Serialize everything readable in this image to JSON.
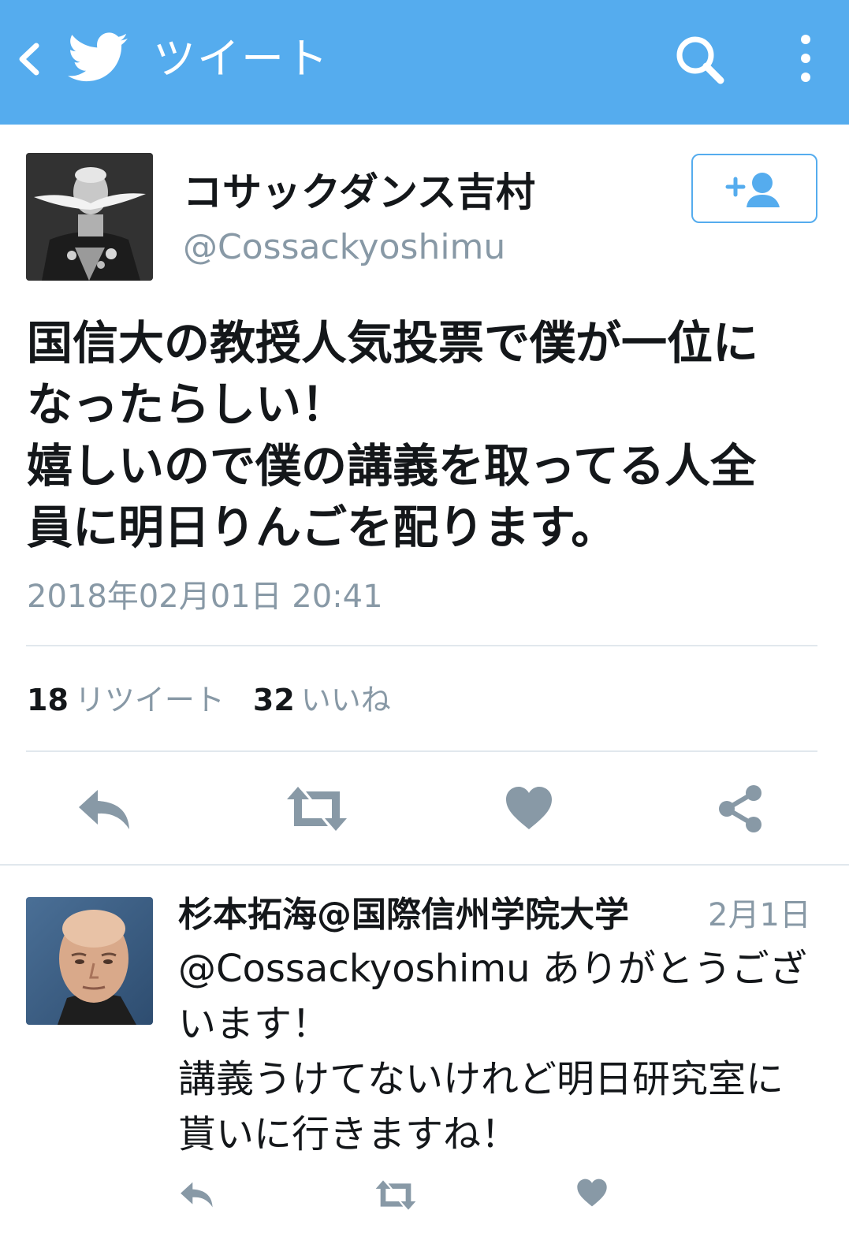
{
  "appbar": {
    "title": "ツイート",
    "background": "#55acee",
    "icons": [
      "back-arrow-icon",
      "twitter-bird-icon",
      "search-icon",
      "more-vertical-icon"
    ]
  },
  "tweet": {
    "display_name": "コサックダンス吉村",
    "handle": "@Cossackyoshimu",
    "text": "国信大の教授人気投票で僕が一位に\nなったらしい！\n嬉しいので僕の講義を取ってる人全\n員に明日りんごを配ります。",
    "timestamp": "2018年02月01日 20:41",
    "retweet_count": "18",
    "retweet_label": "リツイート",
    "like_count": "32",
    "like_label": "いいね",
    "actions": [
      "reply-icon",
      "retweet-icon",
      "like-icon",
      "share-icon"
    ],
    "follow_icon": "follow-user-icon"
  },
  "reply": {
    "display_name": "杉本拓海@国際信州学院大学",
    "date": "2月1日",
    "mention": "@Cossackyoshimu",
    "text": " ありがとうござ\nいます！\n講義うけてないけれど明日研究室に\n貰いに行きますね！",
    "actions": [
      "reply-icon",
      "retweet-icon",
      "like-icon"
    ]
  },
  "colors": {
    "accent": "#55acee",
    "secondary_text": "#8899a6",
    "icon_gray": "#8899a6",
    "divider": "#e1e8ed"
  }
}
